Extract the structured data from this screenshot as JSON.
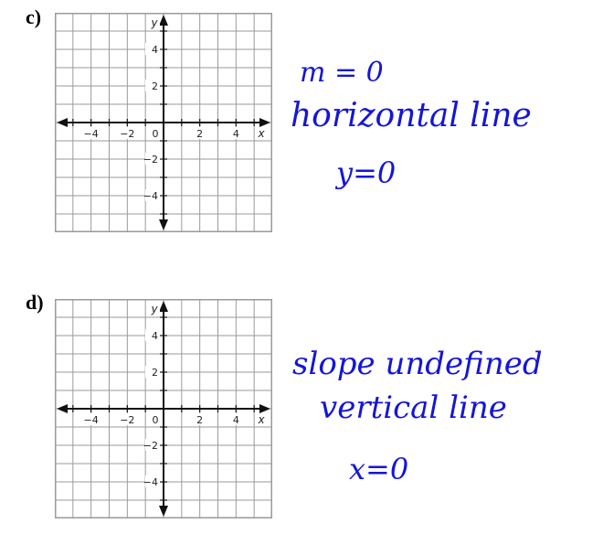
{
  "parts": [
    {
      "id": "c",
      "label": "c)",
      "graph": {
        "x_axis_label": "x",
        "y_axis_label": "y",
        "x_ticks": [
          "−4",
          "−2",
          "0",
          "2",
          "4"
        ],
        "y_ticks": [
          "4",
          "2",
          "−2",
          "−4"
        ]
      },
      "handwriting": [
        "m = 0",
        "horizontal line",
        "y=0"
      ]
    },
    {
      "id": "d",
      "label": "d)",
      "graph": {
        "x_axis_label": "x",
        "y_axis_label": "y",
        "x_ticks": [
          "−4",
          "−2",
          "0",
          "2",
          "4"
        ],
        "y_ticks": [
          "4",
          "2",
          "−2",
          "−4"
        ]
      },
      "handwriting": [
        "slope undefined",
        "vertical line",
        "x=0"
      ]
    }
  ],
  "colors": {
    "ink": "#1515d8",
    "grid": "#9a9a9a",
    "axis": "#111111"
  }
}
